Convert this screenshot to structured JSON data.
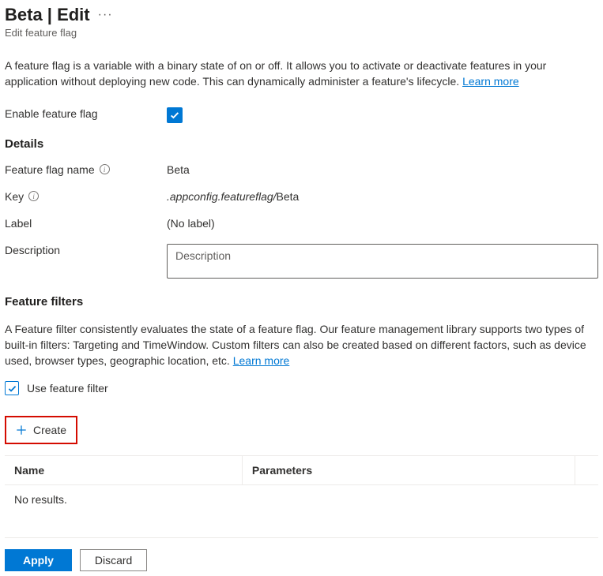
{
  "header": {
    "title": "Beta | Edit",
    "subtitle": "Edit feature flag"
  },
  "intro": {
    "text": "A feature flag is a variable with a binary state of on or off. It allows you to activate or deactivate features in your application without deploying new code. This can dynamically administer a feature's lifecycle. ",
    "learnMore": "Learn more"
  },
  "enable": {
    "label": "Enable feature flag",
    "checked": true
  },
  "details": {
    "heading": "Details",
    "rows": {
      "name": {
        "label": "Feature flag name",
        "value": "Beta"
      },
      "key": {
        "label": "Key",
        "prefix": ".appconfig.featureflag/",
        "suffix": "Beta"
      },
      "labelField": {
        "label": "Label",
        "value": "(No label)"
      },
      "description": {
        "label": "Description",
        "placeholder": "Description"
      }
    }
  },
  "filters": {
    "heading": "Feature filters",
    "intro": "A Feature filter consistently evaluates the state of a feature flag. Our feature management library supports two types of built-in filters: Targeting and TimeWindow. Custom filters can also be created based on different factors, such as device used, browser types, geographic location, etc. ",
    "learnMore": "Learn more",
    "useFilter": {
      "label": "Use feature filter",
      "checked": true
    },
    "createLabel": "Create",
    "table": {
      "colName": "Name",
      "colParams": "Parameters",
      "empty": "No results."
    }
  },
  "footer": {
    "apply": "Apply",
    "discard": "Discard"
  }
}
